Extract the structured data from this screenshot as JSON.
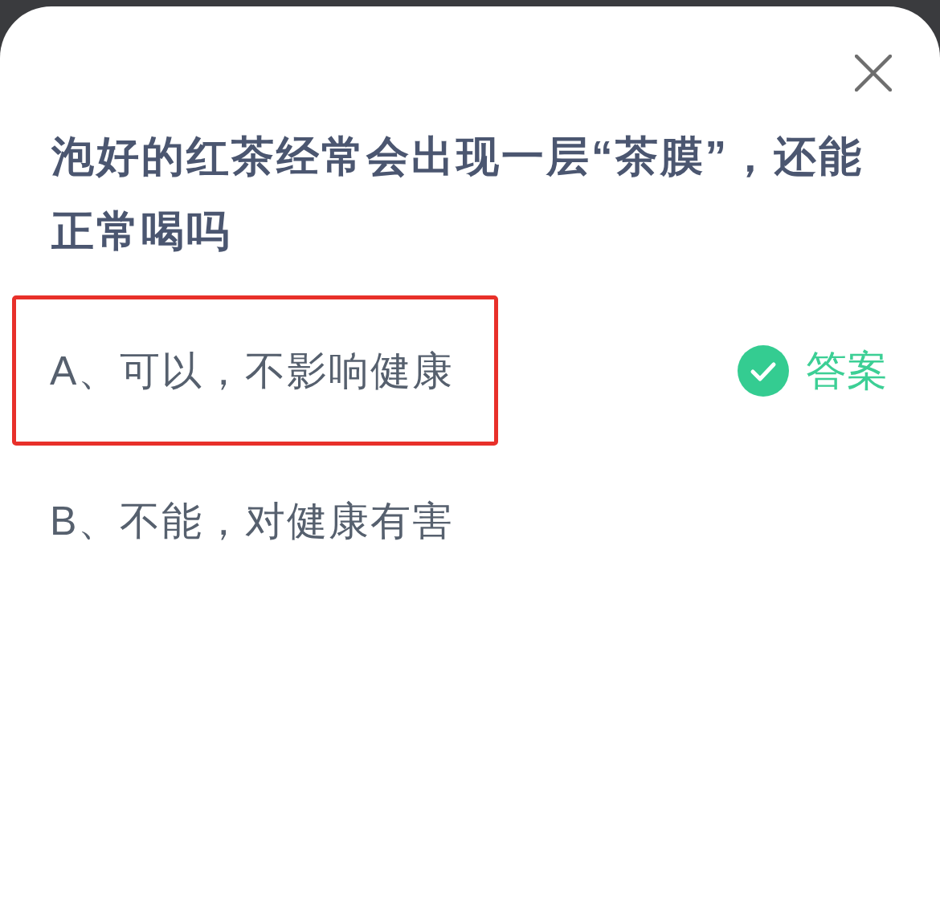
{
  "question": {
    "title": "泡好的红茶经常会出现一层“茶膜”，还能正常喝吗"
  },
  "options": [
    {
      "label": "A、可以，不影响健康",
      "highlighted": true,
      "correct": true,
      "answer_tag": "答案"
    },
    {
      "label": "B、不能，对健康有害",
      "highlighted": false,
      "correct": false
    }
  ]
}
